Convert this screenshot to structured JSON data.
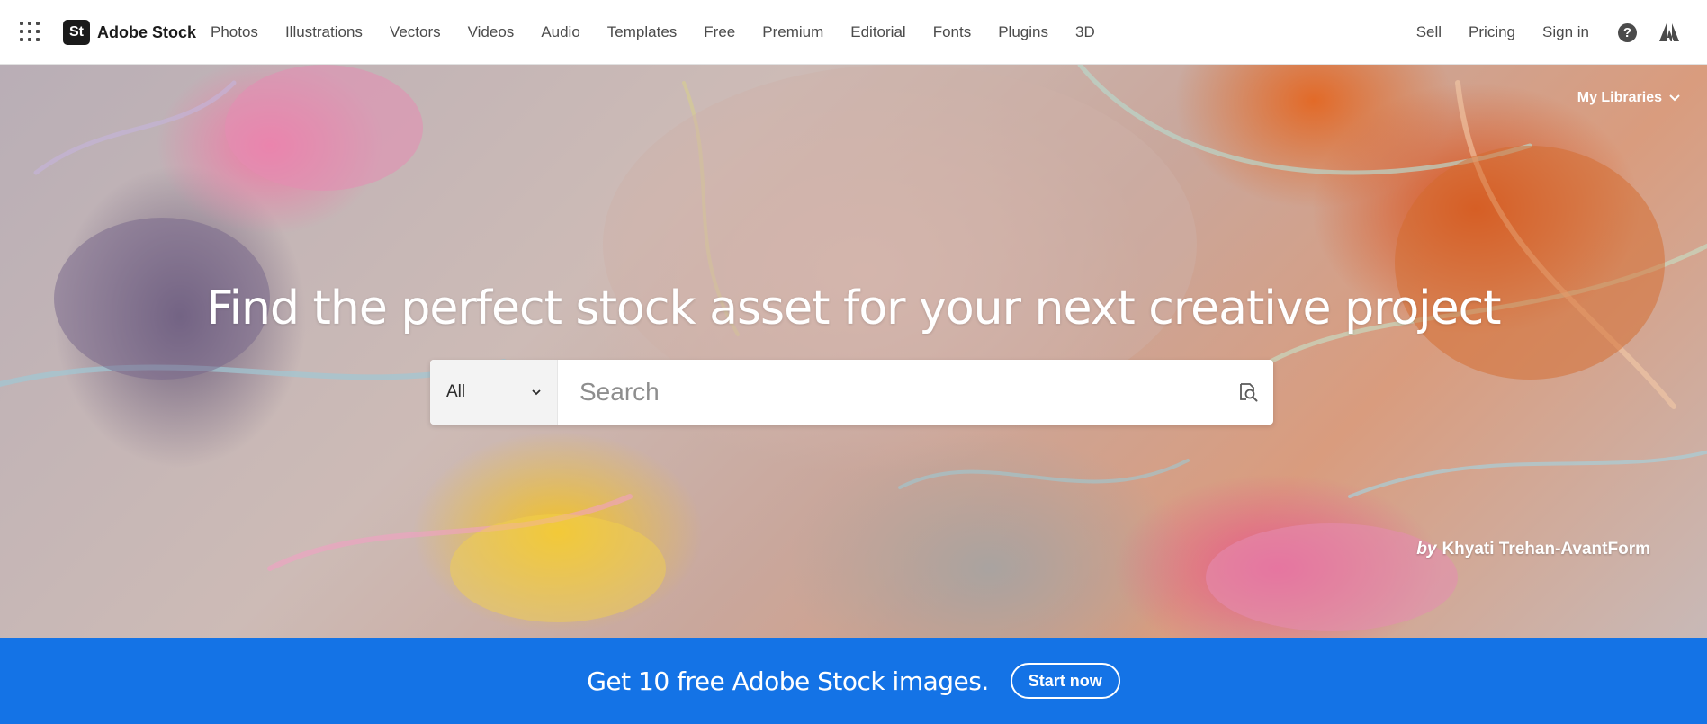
{
  "topnav": {
    "brand_badge": "St",
    "brand_name": "Adobe Stock",
    "links": [
      "Photos",
      "Illustrations",
      "Vectors",
      "Videos",
      "Audio",
      "Templates",
      "Free",
      "Premium",
      "Editorial",
      "Fonts",
      "Plugins",
      "3D"
    ],
    "right_links": [
      "Sell",
      "Pricing",
      "Sign in"
    ],
    "help_icon": "?",
    "icons": [
      "apps-grid-icon",
      "help-icon",
      "adobe-logo-icon"
    ]
  },
  "hero": {
    "my_libraries": "My Libraries",
    "title": "Find the perfect stock asset for your next creative project",
    "search": {
      "category": "All",
      "placeholder": "Search",
      "icons": [
        "chevron-down-icon",
        "visual-search-icon"
      ]
    },
    "credit_prefix": "by",
    "credit_name": "Khyati Trehan-AvantForm"
  },
  "promo": {
    "text": "Get 10 free Adobe Stock images.",
    "button": "Start now"
  },
  "colors": {
    "promo_bg": "#1473e6",
    "nav_text": "#4b4b4b",
    "brand_dark": "#1b1b1b"
  }
}
